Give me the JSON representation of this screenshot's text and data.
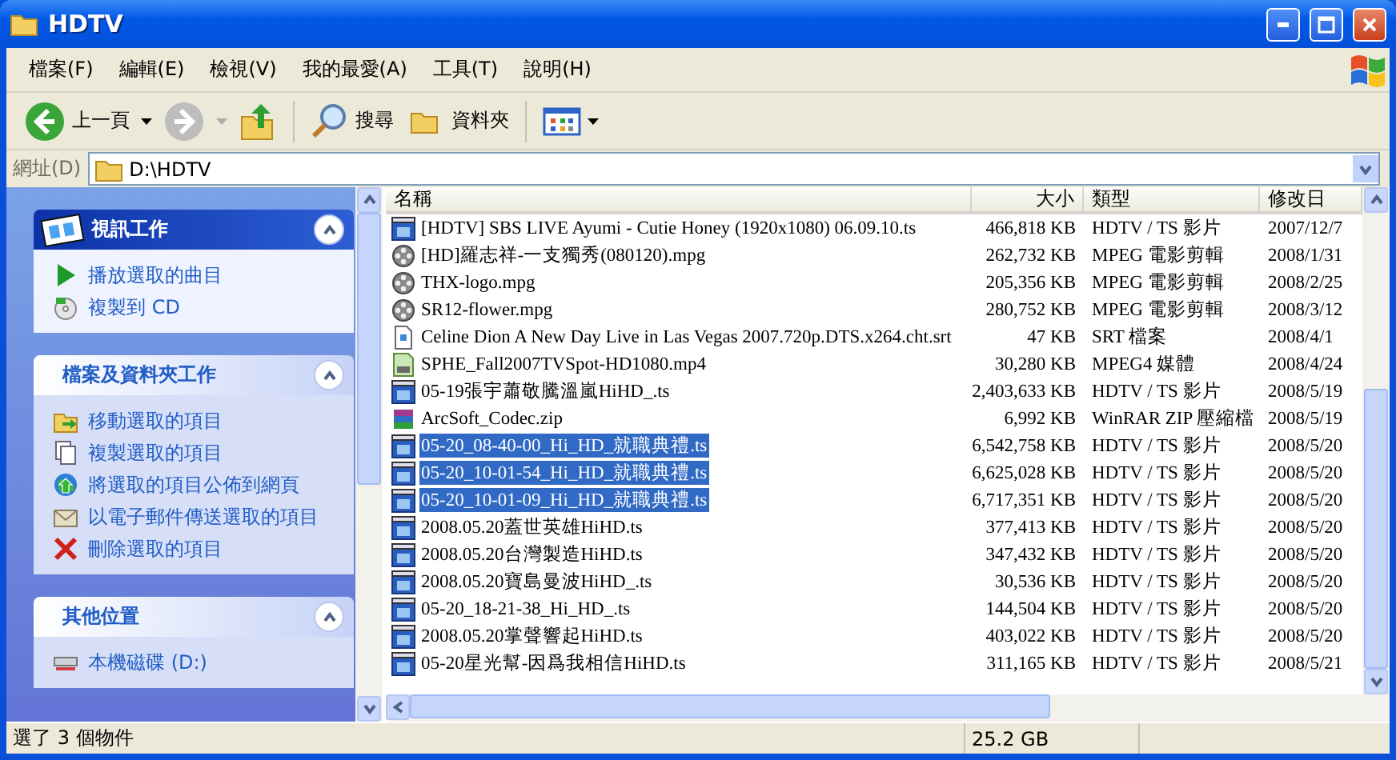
{
  "window": {
    "title": "HDTV"
  },
  "menu": [
    "檔案(F)",
    "編輯(E)",
    "檢視(V)",
    "我的最愛(A)",
    "工具(T)",
    "說明(H)"
  ],
  "toolbar": {
    "back": "上一頁",
    "search": "搜尋",
    "folders": "資料夾"
  },
  "address": {
    "label": "網址(D)",
    "value": "D:\\HDTV"
  },
  "sidebar": {
    "sections": [
      {
        "kind": "special",
        "title": "視訊工作",
        "expanded": true,
        "items": [
          {
            "kind": "play",
            "label": "播放選取的曲目"
          },
          {
            "kind": "cd",
            "label": "複製到 CD"
          }
        ]
      },
      {
        "kind": "normal",
        "title": "檔案及資料夾工作",
        "expanded": true,
        "items": [
          {
            "kind": "move",
            "label": "移動選取的項目"
          },
          {
            "kind": "copy",
            "label": "複製選取的項目"
          },
          {
            "kind": "web",
            "label": "將選取的項目公佈到網頁"
          },
          {
            "kind": "mail",
            "label": "以電子郵件傳送選取的項目"
          },
          {
            "kind": "delete",
            "label": "刪除選取的項目"
          }
        ]
      },
      {
        "kind": "normal",
        "title": "其他位置",
        "expanded": true,
        "items": [
          {
            "kind": "drive",
            "label": "本機磁碟 (D:)"
          }
        ]
      }
    ]
  },
  "table": {
    "columns": [
      "名稱",
      "大小",
      "類型",
      "修改日"
    ],
    "rows": [
      {
        "kind": "ts",
        "name": "[HDTV] SBS LIVE Ayumi - Cutie Honey (1920x1080) 06.09.10.ts",
        "size": "466,818 KB",
        "type": "HDTV / TS 影片",
        "date": "2007/12/7",
        "selected": false
      },
      {
        "kind": "mpg",
        "name": "[HD]羅志祥-一支獨秀(080120).mpg",
        "size": "262,732 KB",
        "type": "MPEG 電影剪輯",
        "date": "2008/1/31",
        "selected": false
      },
      {
        "kind": "mpg",
        "name": "THX-logo.mpg",
        "size": "205,356 KB",
        "type": "MPEG 電影剪輯",
        "date": "2008/2/25",
        "selected": false
      },
      {
        "kind": "mpg",
        "name": "SR12-flower.mpg",
        "size": "280,752 KB",
        "type": "MPEG 電影剪輯",
        "date": "2008/3/12",
        "selected": false
      },
      {
        "kind": "srt",
        "name": "Celine Dion A New Day Live in Las Vegas 2007.720p.DTS.x264.cht.srt",
        "size": "47 KB",
        "type": "SRT 檔案",
        "date": "2008/4/1",
        "selected": false
      },
      {
        "kind": "mp4",
        "name": "SPHE_Fall2007TVSpot-HD1080.mp4",
        "size": "30,280 KB",
        "type": "MPEG4 媒體",
        "date": "2008/4/24",
        "selected": false
      },
      {
        "kind": "ts",
        "name": "05-19張宇蕭敬騰溫嵐HiHD_.ts",
        "size": "2,403,633 KB",
        "type": "HDTV / TS 影片",
        "date": "2008/5/19",
        "selected": false
      },
      {
        "kind": "zip",
        "name": "ArcSoft_Codec.zip",
        "size": "6,992 KB",
        "type": "WinRAR ZIP 壓縮檔",
        "date": "2008/5/19",
        "selected": false
      },
      {
        "kind": "ts",
        "name": "05-20_08-40-00_Hi_HD_就職典禮.ts",
        "size": "6,542,758 KB",
        "type": "HDTV / TS 影片",
        "date": "2008/5/20",
        "selected": true
      },
      {
        "kind": "ts",
        "name": "05-20_10-01-54_Hi_HD_就職典禮.ts",
        "size": "6,625,028 KB",
        "type": "HDTV / TS 影片",
        "date": "2008/5/20",
        "selected": true
      },
      {
        "kind": "ts",
        "name": "05-20_10-01-09_Hi_HD_就職典禮.ts",
        "size": "6,717,351 KB",
        "type": "HDTV / TS 影片",
        "date": "2008/5/20",
        "selected": true
      },
      {
        "kind": "ts",
        "name": "2008.05.20蓋世英雄HiHD.ts",
        "size": "377,413 KB",
        "type": "HDTV / TS 影片",
        "date": "2008/5/20",
        "selected": false
      },
      {
        "kind": "ts",
        "name": "2008.05.20台灣製造HiHD.ts",
        "size": "347,432 KB",
        "type": "HDTV / TS 影片",
        "date": "2008/5/20",
        "selected": false
      },
      {
        "kind": "ts",
        "name": "2008.05.20寶島曼波HiHD_.ts",
        "size": "30,536 KB",
        "type": "HDTV / TS 影片",
        "date": "2008/5/20",
        "selected": false
      },
      {
        "kind": "ts",
        "name": "05-20_18-21-38_Hi_HD_.ts",
        "size": "144,504 KB",
        "type": "HDTV / TS 影片",
        "date": "2008/5/20",
        "selected": false
      },
      {
        "kind": "ts",
        "name": "2008.05.20掌聲響起HiHD.ts",
        "size": "403,022 KB",
        "type": "HDTV / TS 影片",
        "date": "2008/5/20",
        "selected": false
      },
      {
        "kind": "ts",
        "name": "05-20星光幫-因爲我相信HiHD.ts",
        "size": "311,165 KB",
        "type": "HDTV / TS 影片",
        "date": "2008/5/21",
        "selected": false
      }
    ]
  },
  "status_bar": [
    "選了 3 個物件",
    "25.2 GB"
  ]
}
